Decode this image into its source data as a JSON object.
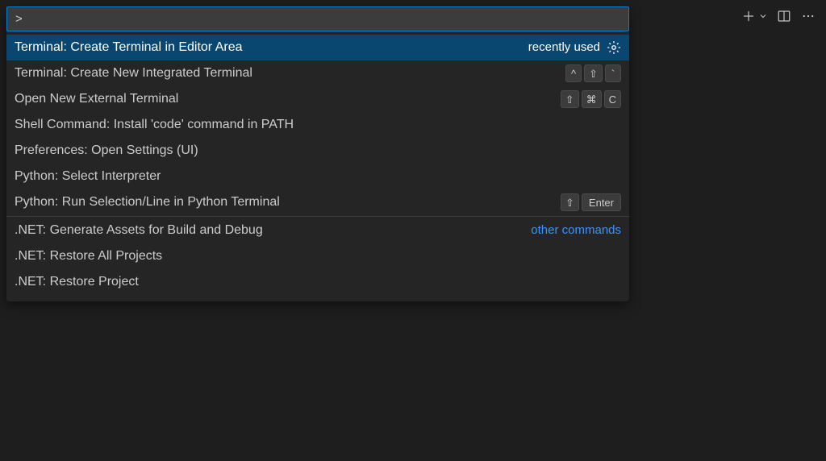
{
  "search": {
    "value": ">"
  },
  "tags": {
    "recently_used": "recently used",
    "other_commands": "other commands"
  },
  "items": [
    {
      "label": "Terminal: Create Terminal in Editor Area"
    },
    {
      "label": "Terminal: Create New Integrated Terminal"
    },
    {
      "label": "Open New External Terminal"
    },
    {
      "label": "Shell Command: Install 'code' command in PATH"
    },
    {
      "label": "Preferences: Open Settings (UI)"
    },
    {
      "label": "Python: Select Interpreter"
    },
    {
      "label": "Python: Run Selection/Line in Python Terminal"
    },
    {
      "label": ".NET: Generate Assets for Build and Debug"
    },
    {
      "label": ".NET: Restore All Projects"
    },
    {
      "label": ".NET: Restore Project"
    }
  ],
  "keys": {
    "ctrl": "^",
    "shift": "⇧",
    "backtick": "`",
    "cmd": "⌘",
    "c": "C",
    "enter": "Enter"
  }
}
